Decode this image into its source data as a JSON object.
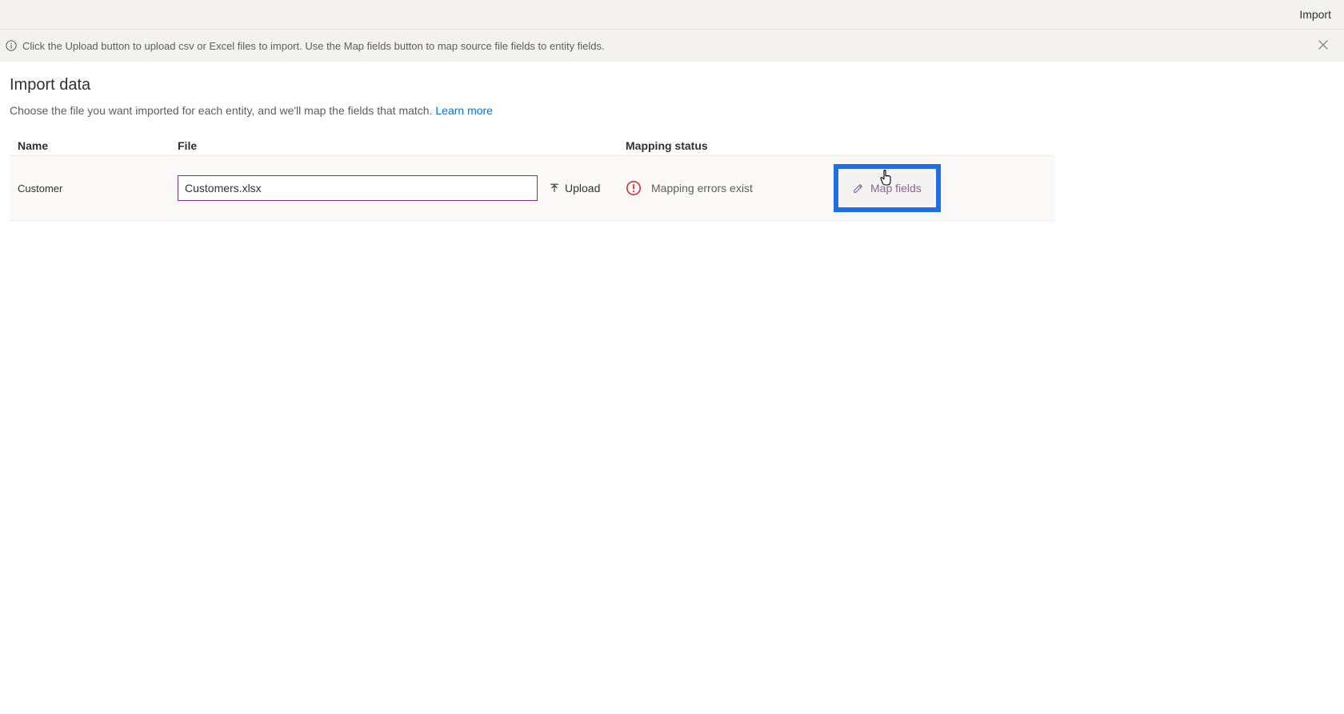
{
  "header": {
    "import_label": "Import"
  },
  "banner": {
    "text": "Click the Upload button to upload csv or Excel files to import. Use the Map fields button to map source file fields to entity fields."
  },
  "page": {
    "title": "Import data",
    "subtitle_prefix": "Choose the file you want imported for each entity, and we'll map the fields that match. ",
    "learn_more": "Learn more"
  },
  "grid": {
    "headers": {
      "name": "Name",
      "file": "File",
      "mapping_status": "Mapping status"
    },
    "rows": [
      {
        "entity": "Customer",
        "file_value": "Customers.xlsx",
        "upload_label": "Upload",
        "status_text": "Mapping errors exist",
        "mapfields_label": "Map fields"
      }
    ]
  }
}
